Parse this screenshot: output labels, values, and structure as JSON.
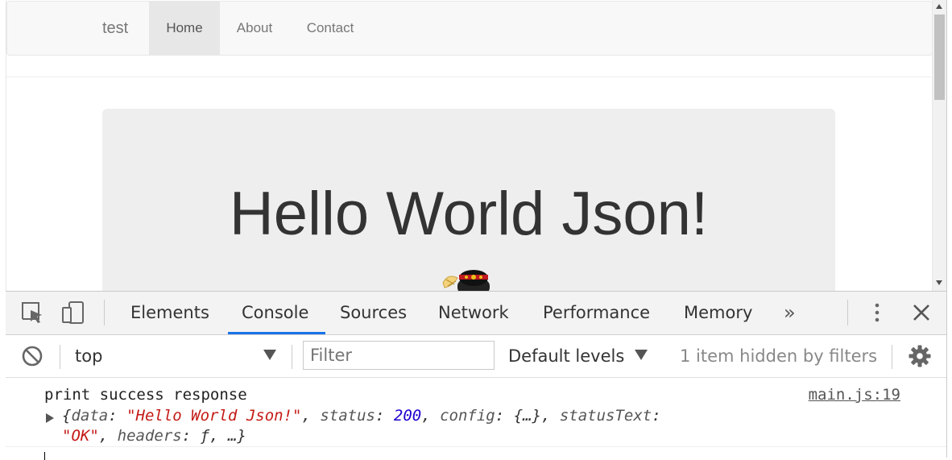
{
  "page": {
    "brand": "test",
    "nav": [
      "Home",
      "About",
      "Contact"
    ],
    "jumbotron_title": "Hello World Json!"
  },
  "devtools": {
    "tabs": [
      "Elements",
      "Console",
      "Sources",
      "Network",
      "Performance",
      "Memory"
    ],
    "active_tab": "Console",
    "more_tabs": "»",
    "context": "top",
    "filter_placeholder": "Filter",
    "levels": "Default levels",
    "hidden_note": "1 item hidden by filters"
  },
  "console": {
    "message": "print success response",
    "source": "main.js:19",
    "object": {
      "open": "{",
      "k_data": "data",
      "v_data": "\"Hello World Json!\"",
      "k_status": "status",
      "v_status": "200",
      "k_config": "config",
      "v_config": "{…}",
      "k_statusText": "statusText",
      "v_statusText": "\"OK\"",
      "k_headers": "headers",
      "v_headers": "ƒ",
      "ellipsis": "…",
      "close": "}"
    }
  },
  "colors": {
    "accent": "#1a73e8",
    "string": "#c41a16",
    "number": "#1c00cf"
  }
}
